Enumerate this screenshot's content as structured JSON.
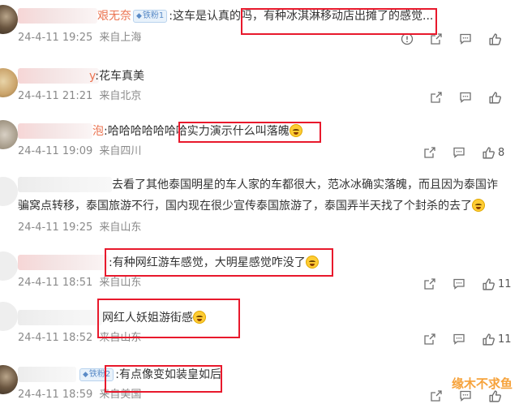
{
  "colors": {
    "username": "#eb7350",
    "highlight_box": "#e8192c",
    "meta_text": "#8a8a8a",
    "watermark": "#f6a23a"
  },
  "comments": [
    {
      "name": "艰无奈",
      "badge": "铁粉1",
      "text": ":这车是认真的吗，有种冰淇淋移动店出摊了的感觉...",
      "date": "24-4-11 19:25",
      "location": "来自上海",
      "likes": ""
    },
    {
      "name": "y",
      "text": ":花车真美",
      "date": "24-4-11 21:21",
      "location": "来自北京",
      "likes": ""
    },
    {
      "name": "泡",
      "text": ":哈哈哈哈哈哈哈实力演示什么叫落魄",
      "date": "24-4-11 19:09",
      "location": "来自四川",
      "likes": "8"
    },
    {
      "name": "",
      "text_line1": "去看了其他泰国明星的车人家的车都很大，范冰冰确实落魄，而且因为泰国诈",
      "text_line2": "骗窝点转移，泰国旅游不行，国内现在很少宣传泰国旅游了，泰国弄半天找了个封杀的去了",
      "date": "24-4-11 19:25",
      "location": "来自山东",
      "likes": ""
    },
    {
      "name": "",
      "text": ":有种网红游车感觉，大明星感觉咋没了",
      "date": "24-4-11 18:51",
      "location": "来自山东",
      "likes": "11"
    },
    {
      "name": "",
      "text": "网红人妖姐游街感",
      "date": "24-4-11 18:52",
      "location": "来自山东",
      "likes": "11"
    },
    {
      "name": "",
      "badge": "铁粉2",
      "text": ":有点像变如装皇如后",
      "date": "24-4-11 18:59",
      "location": "来自美国",
      "likes": ""
    }
  ],
  "watermark": "缘木不求鱼"
}
